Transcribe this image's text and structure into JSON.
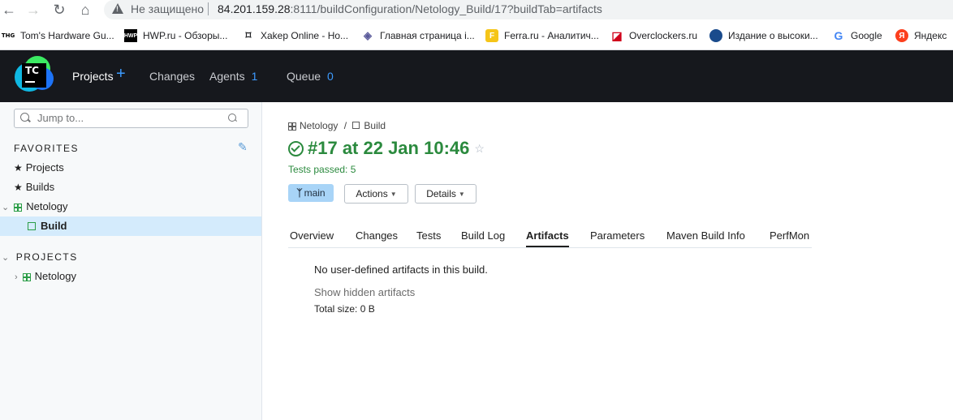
{
  "browser": {
    "url_security": "Не защищено",
    "url_host": "84.201.159.28",
    "url_path": ":8111/buildConfiguration/Netology_Build/17?buildTab=artifacts",
    "bookmarks": [
      {
        "label": "Tom's Hardware Gu...",
        "icon": "toms-hardware-icon"
      },
      {
        "label": "HWP.ru - Обзоры...",
        "icon": "hwp-icon"
      },
      {
        "label": "Xakep Online - Но...",
        "icon": "xakep-icon"
      },
      {
        "label": "Главная страница i...",
        "icon": "ixbt-icon"
      },
      {
        "label": "Ferra.ru - Аналитич...",
        "icon": "ferra-icon"
      },
      {
        "label": "Overclockers.ru",
        "icon": "overclockers-icon"
      },
      {
        "label": "Издание о высоки...",
        "icon": "habr-icon"
      },
      {
        "label": "Google",
        "icon": "google-icon"
      },
      {
        "label": "Яндекс",
        "icon": "yandex-icon"
      }
    ]
  },
  "header": {
    "logo_text": "TC",
    "nav": {
      "projects": "Projects",
      "changes": "Changes",
      "agents": "Agents",
      "agents_count": "1",
      "queue": "Queue",
      "queue_count": "0"
    }
  },
  "sidebar": {
    "search_placeholder": "Jump to...",
    "favorites_title": "FAVORITES",
    "favorites": [
      "Projects",
      "Builds"
    ],
    "tree_project": "Netology",
    "tree_build": "Build",
    "projects_title": "PROJECTS",
    "projects": [
      "Netology"
    ]
  },
  "main": {
    "breadcrumb_project": "Netology",
    "breadcrumb_sep": "/",
    "breadcrumb_build": "Build",
    "title": "#17 at 22 Jan 10:46",
    "tests_passed": "Tests passed: 5",
    "branch": "main",
    "actions_label": "Actions",
    "details_label": "Details",
    "tabs": [
      "Overview",
      "Changes",
      "Tests",
      "Build Log",
      "Artifacts",
      "Parameters",
      "Maven Build Info",
      "PerfMon"
    ],
    "active_tab": "Artifacts",
    "no_artifacts": "No user-defined artifacts in this build.",
    "show_hidden": "Show hidden artifacts",
    "total_size": "Total size: 0 B"
  },
  "colors": {
    "header_bg": "#16181d",
    "success_green": "#2b8a3e",
    "accent_blue": "#3d9bff",
    "selected_row": "#d4ebfc"
  }
}
